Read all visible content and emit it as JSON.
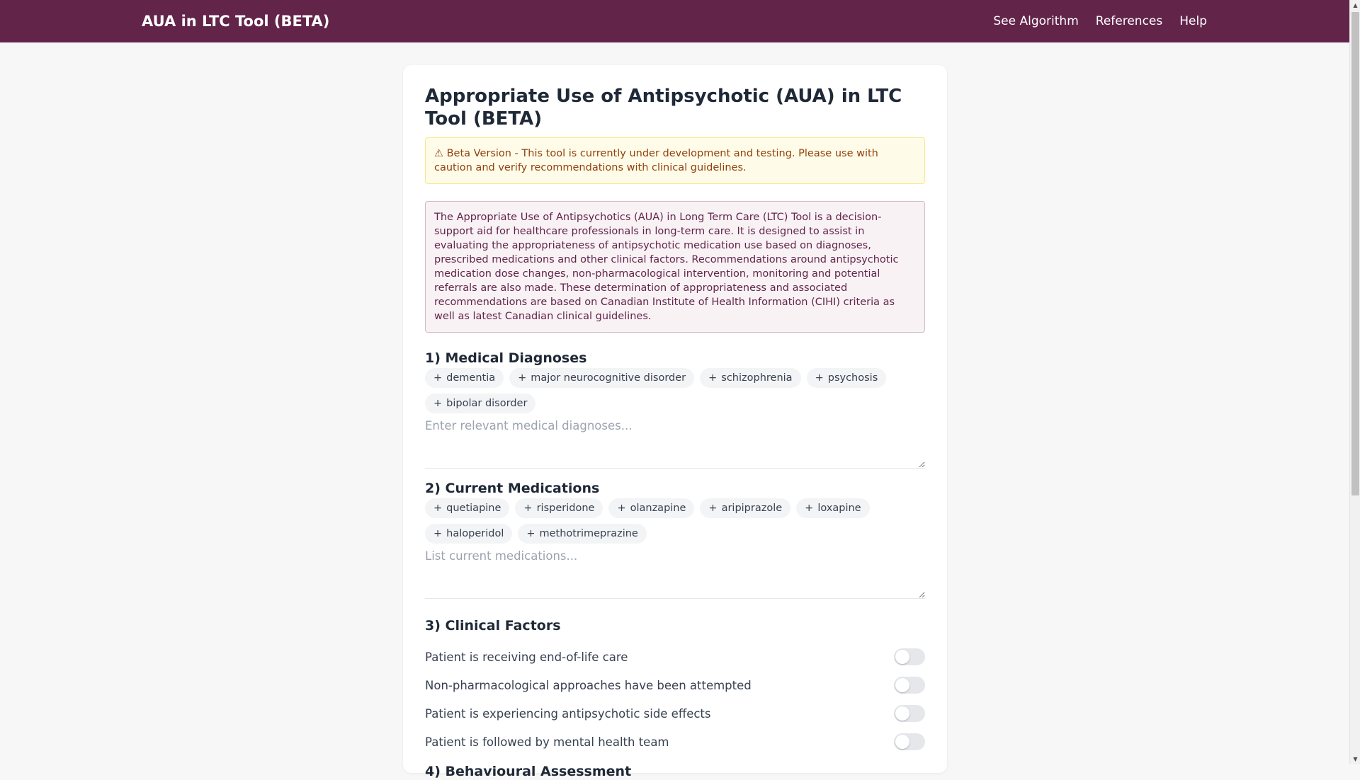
{
  "navbar": {
    "brand": "AUA in LTC Tool (BETA)",
    "links": [
      "See Algorithm",
      "References",
      "Help"
    ],
    "bg_color": "#63244a"
  },
  "page": {
    "title": "Appropriate Use of Antipsychotic (AUA) in LTC Tool (BETA)",
    "beta_alert": "⚠ Beta Version - This tool is currently under development and testing. Please use with caution and verify recommendations with clinical guidelines.",
    "intro": "The Appropriate Use of Antipsychotics (AUA) in Long Term Care (LTC) Tool is a decision-support aid for healthcare professionals in long-term care. It is designed to assist in evaluating the appropriateness of antipsychotic medication use based on diagnoses, prescribed medications and other clinical factors. Recommendations around antipsychotic medication dose changes, non-pharmacological intervention, monitoring and potential referrals are also made. These determination of appropriateness and associated recommendations are based on Canadian Institute of Health Information (CIHI) criteria as well as latest Canadian clinical guidelines."
  },
  "diagnoses": {
    "heading": "1) Medical Diagnoses",
    "chips": [
      "dementia",
      "major neurocognitive disorder",
      "schizophrenia",
      "psychosis",
      "bipolar disorder"
    ],
    "placeholder": "Enter relevant medical diagnoses..."
  },
  "medications": {
    "heading": "2) Current Medications",
    "chips": [
      "quetiapine",
      "risperidone",
      "olanzapine",
      "aripiprazole",
      "loxapine",
      "haloperidol",
      "methotrimeprazine"
    ],
    "placeholder": "List current medications..."
  },
  "factors": {
    "heading": "3) Clinical Factors",
    "items": [
      {
        "label": "Patient is receiving end-of-life care",
        "on": false
      },
      {
        "label": "Non-pharmacological approaches have been attempted",
        "on": false
      },
      {
        "label": "Patient is experiencing antipsychotic side effects",
        "on": false
      },
      {
        "label": "Patient is followed by mental health team",
        "on": false
      }
    ]
  },
  "behavioural": {
    "heading": "4) Behavioural Assessment"
  },
  "icons": {
    "chip_plus": "plus-icon",
    "scroll_up": "scroll-up-arrow-icon",
    "scroll_down": "scroll-down-arrow-icon"
  }
}
